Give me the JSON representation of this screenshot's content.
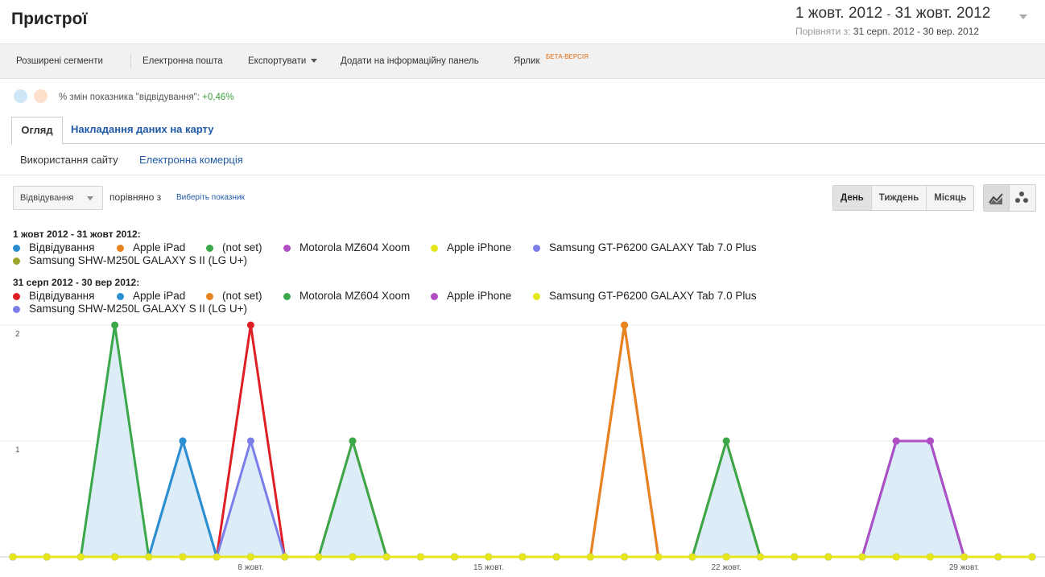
{
  "page": {
    "title": "Пристрої",
    "date_range": {
      "start": "1 жовт. 2012",
      "sep": "-",
      "end": "31 жовт. 2012",
      "compare_label": "Порівняти з:",
      "compare_value": "31 серп. 2012 - 30 вер. 2012"
    }
  },
  "toolbar": {
    "advanced_segments": "Розширені сегменти",
    "email": "Електронна пошта",
    "export": "Експортувати",
    "add_dashboard": "Додати на інформаційну панель",
    "shortcut": "Ярлик",
    "beta": "БЕТА-ВЕРСІЯ"
  },
  "summary": {
    "label": "% змін показника \"відвідування\":",
    "value": "+0,46%"
  },
  "tabs": {
    "overview": "Огляд",
    "map_overlay": "Накладання даних на карту"
  },
  "subtabs": {
    "site_usage": "Використання сайту",
    "ecommerce": "Електронна комерція"
  },
  "controls": {
    "metric": "Відвідування",
    "compared_with": "порівняно з",
    "choose_metric": "Виберіть показник",
    "periods": [
      "День",
      "Тиждень",
      "Місяць"
    ],
    "active_period": "День",
    "view_icons": [
      "line-chart-icon",
      "motion-chart-icon"
    ]
  },
  "legend": {
    "current_header": "1 жовт 2012 - 31 жовт 2012:",
    "current": [
      {
        "label": "Відвідування",
        "color": "#2a8fd0"
      },
      {
        "label": "Apple iPad",
        "color": "#e8841f"
      },
      {
        "label": "(not set)",
        "color": "#3aa84a"
      },
      {
        "label": "Motorola MZ604 Xoom",
        "color": "#b04fc4"
      },
      {
        "label": "Apple iPhone",
        "color": "#e5e61b"
      },
      {
        "label": "Samsung GT-P6200 GALAXY Tab 7.0 Plus",
        "color": "#7b7ee8"
      },
      {
        "label": "Samsung SHW-M250L GALAXY S II (LG U+)",
        "color": "#9aa52a"
      }
    ],
    "previous_header": "31 серп 2012 - 30 вер 2012:",
    "previous": [
      {
        "label": "Відвідування",
        "color": "#df1f26"
      },
      {
        "label": "Apple iPad",
        "color": "#2a8fd0"
      },
      {
        "label": "(not set)",
        "color": "#e8841f"
      },
      {
        "label": "Motorola MZ604 Xoom",
        "color": "#3aa84a"
      },
      {
        "label": "Apple iPhone",
        "color": "#b04fc4"
      },
      {
        "label": "Samsung GT-P6200 GALAXY Tab 7.0 Plus",
        "color": "#e5e61b"
      },
      {
        "label": "Samsung SHW-M250L GALAXY S II (LG U+)",
        "color": "#7b7ee8"
      }
    ]
  },
  "chart_data": {
    "type": "area",
    "ylim": [
      0,
      2
    ],
    "yticks": [
      "2",
      "1"
    ],
    "x_tick_labels": [
      {
        "day": 8,
        "label": "8 жовт."
      },
      {
        "day": 15,
        "label": "15 жовт."
      },
      {
        "day": 22,
        "label": "22 жовт."
      },
      {
        "day": 29,
        "label": "29 жовт."
      }
    ],
    "days": 31,
    "fill_color": "#dcedf7",
    "current_visits": [
      0,
      0,
      0,
      2,
      0,
      1,
      0,
      1,
      0,
      0,
      1,
      0,
      0,
      0,
      0,
      0,
      0,
      0,
      0,
      0,
      0,
      1,
      0,
      0,
      0,
      0,
      1,
      1,
      0,
      0,
      0
    ],
    "series": [
      {
        "name": "Відвідування (31 серп 2012 - 30 вер 2012)",
        "color": "#df1f26",
        "values": [
          0,
          0,
          0,
          0,
          0,
          0,
          0,
          2,
          0,
          0,
          0,
          0,
          0,
          0,
          0,
          0,
          0,
          0,
          2,
          0,
          0,
          0,
          0,
          0,
          0,
          0,
          0,
          0,
          0,
          0,
          0
        ]
      },
      {
        "name": "Apple iPad",
        "color": "#e8841f",
        "values": [
          0,
          0,
          0,
          0,
          0,
          0,
          0,
          0,
          0,
          0,
          1,
          0,
          0,
          0,
          0,
          0,
          0,
          0,
          2,
          0,
          0,
          1,
          0,
          0,
          0,
          0,
          0,
          0,
          0,
          0,
          0
        ]
      },
      {
        "name": "(not set)",
        "color": "#3aa84a",
        "values": [
          0,
          0,
          0,
          2,
          0,
          0,
          0,
          0,
          0,
          0,
          1,
          0,
          0,
          0,
          0,
          0,
          0,
          0,
          0,
          0,
          0,
          1,
          0,
          0,
          0,
          0,
          0,
          0,
          0,
          0,
          0
        ]
      },
      {
        "name": "Samsung GT-P6200 GALAXY Tab 7.0 Plus",
        "color": "#7b7ee8",
        "values": [
          0,
          0,
          0,
          0,
          0,
          1,
          0,
          1,
          0,
          0,
          0,
          0,
          0,
          0,
          0,
          0,
          0,
          0,
          0,
          0,
          0,
          0,
          0,
          0,
          0,
          0,
          1,
          1,
          0,
          0,
          0
        ]
      },
      {
        "name": "Відвідування",
        "color": "#2a8fd0",
        "values": [
          0,
          0,
          0,
          0,
          0,
          1,
          0,
          0,
          0,
          0,
          0,
          0,
          0,
          0,
          0,
          0,
          0,
          0,
          0,
          0,
          0,
          0,
          0,
          0,
          0,
          0,
          1,
          1,
          0,
          0,
          0
        ]
      },
      {
        "name": "Motorola MZ604 Xoom",
        "color": "#b04fc4",
        "values": [
          0,
          0,
          0,
          0,
          0,
          0,
          0,
          0,
          0,
          0,
          0,
          0,
          0,
          0,
          0,
          0,
          0,
          0,
          0,
          0,
          0,
          0,
          0,
          0,
          0,
          0,
          1,
          1,
          0,
          0,
          0
        ]
      },
      {
        "name": "Apple iPhone",
        "color": "#e5e61b",
        "values": [
          0,
          0,
          0,
          0,
          0,
          0,
          0,
          0,
          0,
          0,
          0,
          0,
          0,
          0,
          0,
          0,
          0,
          0,
          0,
          0,
          0,
          0,
          0,
          0,
          0,
          0,
          0,
          0,
          0,
          0,
          0
        ]
      }
    ]
  }
}
